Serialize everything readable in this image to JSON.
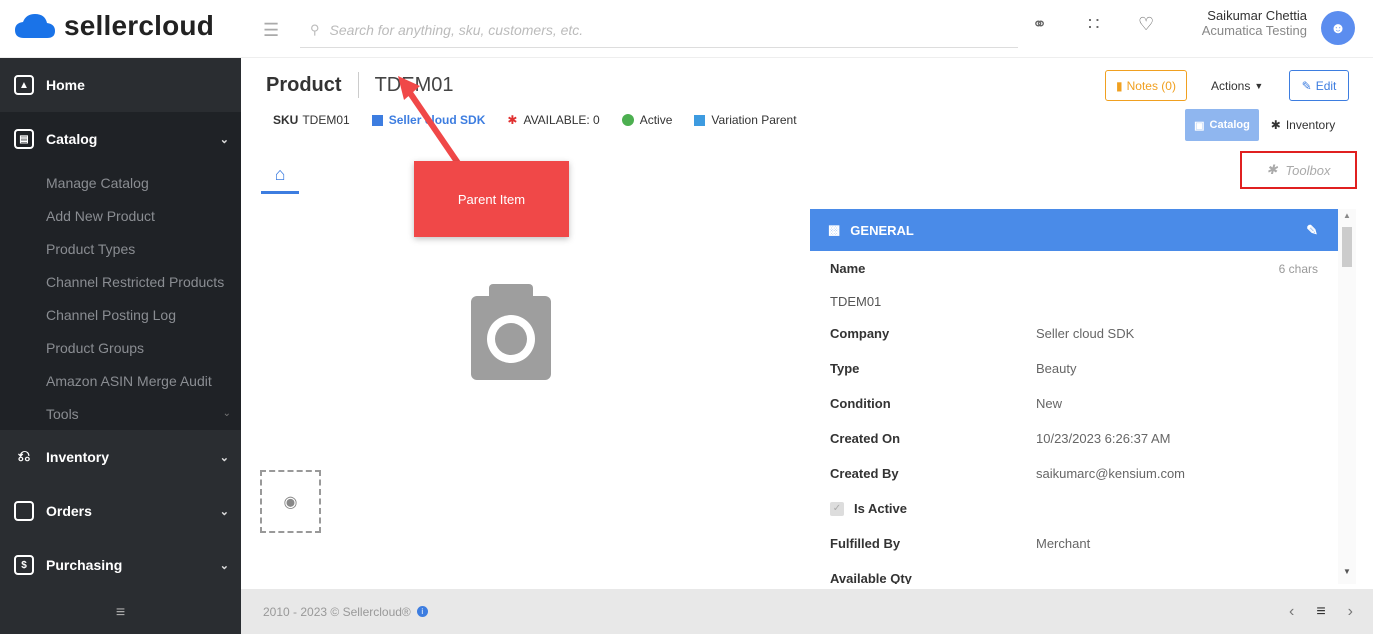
{
  "app": {
    "name": "sellercloud"
  },
  "header": {
    "search_placeholder": "Search for anything, sku, customers, etc.",
    "user_name": "Saikumar Chettia",
    "user_org": "Acumatica Testing"
  },
  "sidebar": {
    "items": [
      {
        "label": "Home"
      },
      {
        "label": "Catalog"
      },
      {
        "label": "Inventory"
      },
      {
        "label": "Orders"
      },
      {
        "label": "Purchasing"
      }
    ],
    "catalog_sub": [
      {
        "label": "Manage Catalog"
      },
      {
        "label": "Add New Product"
      },
      {
        "label": "Product Types"
      },
      {
        "label": "Channel Restricted Products"
      },
      {
        "label": "Channel Posting Log"
      },
      {
        "label": "Product Groups"
      },
      {
        "label": "Amazon ASIN Merge Audit"
      },
      {
        "label": "Tools"
      }
    ]
  },
  "page": {
    "title_label": "Product",
    "title_sku": "TDEM01",
    "meta": {
      "sku_label": "SKU",
      "sku_value": "TDEM01",
      "company": "Seller cloud SDK",
      "available": "AVAILABLE: 0",
      "status": "Active",
      "variation": "Variation Parent"
    },
    "buttons": {
      "notes": "Notes (0)",
      "actions": "Actions",
      "edit": "Edit",
      "catalog_tab": "Catalog",
      "inventory_tab": "Inventory",
      "toolbox": "Toolbox"
    },
    "callout": "Parent Item"
  },
  "general": {
    "title": "GENERAL",
    "name_label": "Name",
    "name_hint": "6 chars",
    "name_value": "TDEM01",
    "fields": [
      {
        "label": "Company",
        "value": "Seller cloud SDK"
      },
      {
        "label": "Type",
        "value": "Beauty"
      },
      {
        "label": "Condition",
        "value": "New"
      },
      {
        "label": "Created On",
        "value": "10/23/2023 6:26:37 AM"
      },
      {
        "label": "Created By",
        "value": "saikumarc@kensium.com"
      }
    ],
    "is_active_label": "Is Active",
    "fulfilled_label": "Fulfilled By",
    "fulfilled_value": "Merchant",
    "available_label": "Available Qty"
  },
  "footer": {
    "copyright": "2010 - 2023 © Sellercloud®"
  },
  "colors": {
    "accent": "#4a8be8",
    "notes": "#f0a020",
    "callout": "#f04848",
    "sidebar": "#2a2d31"
  }
}
